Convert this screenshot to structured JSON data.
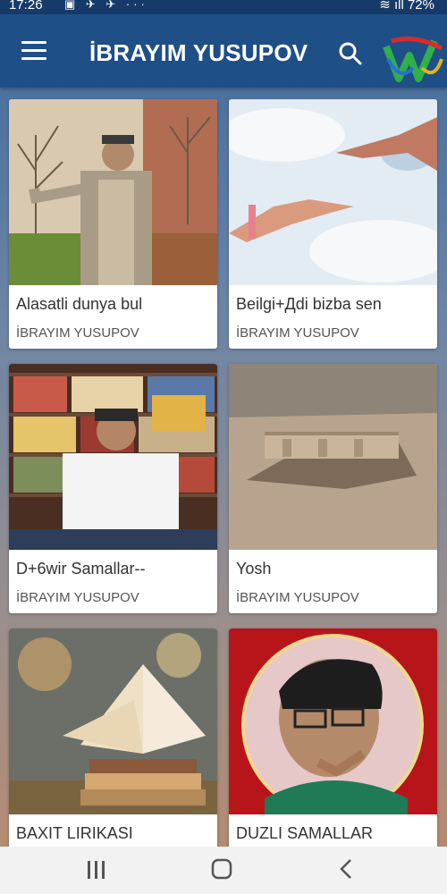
{
  "status_bar": {
    "time": "17:26",
    "left_icons": "▣ ✈ ✈ ···",
    "battery": "72%"
  },
  "app_bar": {
    "title": "İBRAYIM YUSUPOV"
  },
  "cards": [
    {
      "title": "Alasatli dunya bul",
      "author": "İBRAYIM YUSUPOV",
      "image": "man-in-garden"
    },
    {
      "title": "Beilgi+Дdi bizba sen",
      "author": "İBRAYIM YUSUPOV",
      "image": "reaching-hands"
    },
    {
      "title": "D+6wir Samallar--",
      "author": "İBRAYIM YUSUPOV",
      "image": "man-at-desk"
    },
    {
      "title": "Yosh",
      "author": "İBRAYIM YUSUPOV",
      "image": "desert-fortress"
    },
    {
      "title": "BAXIT LIRIKASI",
      "author": "",
      "image": "open-book-stack"
    },
    {
      "title": "DUZLI SAMALLAR",
      "author": "",
      "image": "portrait-ornament"
    }
  ],
  "colors": {
    "status_bar": "#163a69",
    "app_bar": "#1f4f87",
    "nav_bar": "#f2f2f2"
  }
}
